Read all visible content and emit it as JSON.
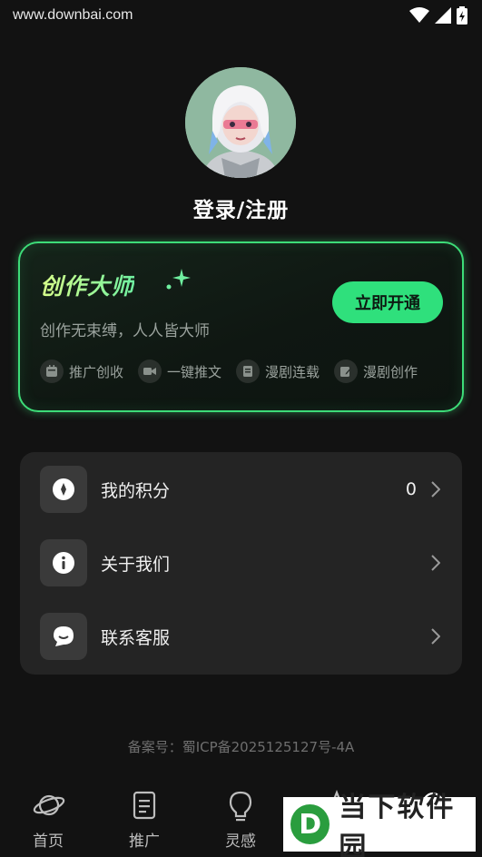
{
  "status_bar": {
    "url": "www.downbai.com"
  },
  "profile": {
    "login_label": "登录/注册"
  },
  "vip_card": {
    "title": "创作大师",
    "subtitle": "创作无束缚，人人皆大师",
    "button_label": "立即开通",
    "features": [
      {
        "label": "推广创收",
        "icon": "calendar-icon"
      },
      {
        "label": "一键推文",
        "icon": "video-icon"
      },
      {
        "label": "漫剧连载",
        "icon": "book-icon"
      },
      {
        "label": "漫剧创作",
        "icon": "edit-icon"
      }
    ],
    "accent": "#3ddc78"
  },
  "menu": {
    "items": [
      {
        "label": "我的积分",
        "value": "0",
        "icon": "points-icon"
      },
      {
        "label": "关于我们",
        "value": "",
        "icon": "info-icon"
      },
      {
        "label": "联系客服",
        "value": "",
        "icon": "chat-icon"
      }
    ]
  },
  "footer": {
    "icp": "备案号：蜀ICP备2025125127号-4A"
  },
  "tabbar": {
    "tabs": [
      {
        "label": "首页",
        "icon": "planet-icon"
      },
      {
        "label": "推广",
        "icon": "document-icon"
      },
      {
        "label": "灵感",
        "icon": "lightbulb-icon"
      },
      {
        "label": "",
        "icon": "star-icon"
      },
      {
        "label": "",
        "icon": "profile-icon"
      }
    ]
  },
  "watermark": {
    "logo_letter": "D",
    "text": "当下软件园"
  }
}
